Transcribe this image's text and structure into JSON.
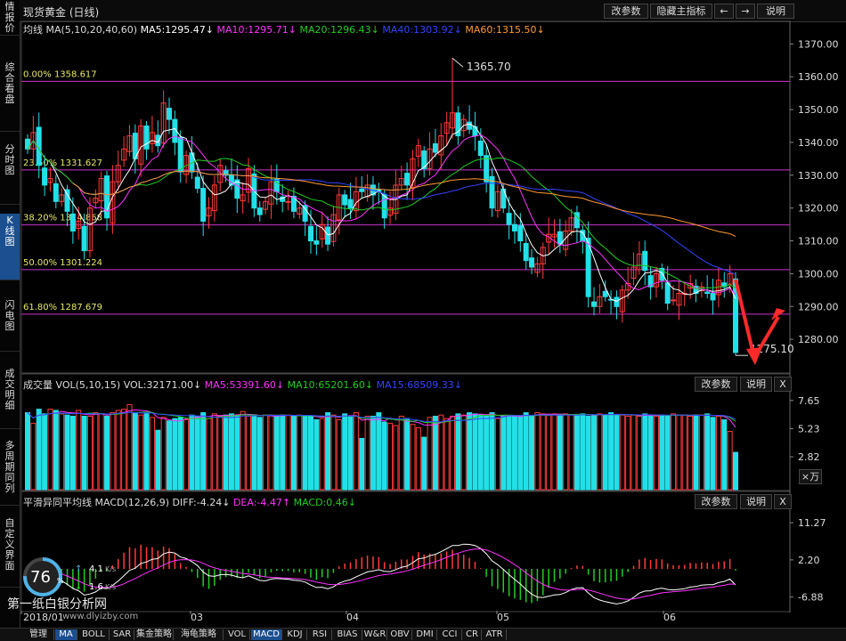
{
  "sidebar": {
    "items": [
      "情报价",
      "综合看盘",
      "分时图",
      "K线图",
      "闪电图",
      "成交明细",
      "多周期同列",
      "自定义界面"
    ],
    "active_index": 3
  },
  "header": {
    "title": "现货黄金 (日线)",
    "buttons": [
      "改参数",
      "隐藏主指标",
      "←",
      "→",
      "说明"
    ]
  },
  "ma_legend": {
    "name": "均线",
    "params": "MA(5,10,20,40,60)",
    "items": [
      {
        "label": "MA5:1295.47↓",
        "color": "#ffffff"
      },
      {
        "label": "MA10:1295.71↓",
        "color": "#ff33ff"
      },
      {
        "label": "MA20:1296.43↓",
        "color": "#22cc22"
      },
      {
        "label": "MA40:1303.92↓",
        "color": "#3344ff"
      },
      {
        "label": "MA60:1315.50↓",
        "color": "#ff9933"
      }
    ]
  },
  "fib_levels": [
    {
      "label": "0.00% 1358.617",
      "value": 1358.617
    },
    {
      "label": "23.60% 1331.627",
      "value": 1331.627
    },
    {
      "label": "38.20% 1314.868",
      "value": 1314.868
    },
    {
      "label": "50.00% 1301.224",
      "value": 1301.224
    },
    {
      "label": "61.80% 1287.679",
      "value": 1287.679
    }
  ],
  "annotations": {
    "high": "1365.70",
    "high_value": 1365.7,
    "low": "1275.10",
    "low_value": 1275.1
  },
  "volume_panel": {
    "title": "成交量",
    "params": "VOL(5,10,15)",
    "items": [
      {
        "label": "VOL:32171.00↓",
        "color": "#dddddd"
      },
      {
        "label": "MA5:53391.60↓",
        "color": "#ff33ff"
      },
      {
        "label": "MA10:65201.60↓",
        "color": "#22cc22"
      },
      {
        "label": "MA15:68509.33↓",
        "color": "#3344ff"
      }
    ],
    "buttons": [
      "改参数",
      "说明",
      "X"
    ],
    "unit": "×万"
  },
  "macd_panel": {
    "title": "平滑异同平均线",
    "params": "MACD(12,26,9)",
    "items": [
      {
        "label": "DIFF:-4.24↓",
        "color": "#dddddd"
      },
      {
        "label": "DEA:-4.47↑",
        "color": "#ff33ff"
      },
      {
        "label": "MACD:0.46↓",
        "color": "#22cc22"
      }
    ],
    "buttons": [
      "改参数",
      "说明",
      "X"
    ]
  },
  "x_axis": {
    "labels": [
      "2018/01",
      "03",
      "04",
      "05",
      "06"
    ]
  },
  "speed": {
    "percent": "76",
    "unit": "%",
    "up": "4.1",
    "up_unit": "K/s",
    "down": "1.6",
    "down_unit": "K/s"
  },
  "watermark": {
    "text": "第一纸白银分析网",
    "url": "www.dlyizby.com"
  },
  "bottom_tabs": [
    "管理",
    "MA",
    "BOLL",
    "SAR",
    "集金策略",
    "海龟策略",
    "VOL",
    "MACD",
    "KDJ",
    "RSI",
    "BIAS",
    "W&R",
    "OBV",
    "DMI",
    "CCI",
    "CR",
    "ATR"
  ],
  "bottom_active": [
    1,
    7
  ],
  "chart_data": {
    "type": "candlestick",
    "price_ylim": [
      1270,
      1372
    ],
    "price_ticks": [
      1370,
      1360,
      1350,
      1340,
      1330,
      1320,
      1310,
      1300,
      1290,
      1280
    ],
    "volume_ticks": [
      "7.65",
      "5.23",
      "2.82"
    ],
    "volume_tick_values": [
      7.65,
      5.23,
      2.82
    ],
    "volume_ylim": [
      0,
      8.4
    ],
    "macd_ticks": [
      "11.27",
      "2.20",
      "-6.88"
    ],
    "macd_tick_values": [
      11.27,
      2.2,
      -6.88
    ],
    "macd_ylim": [
      -10,
      15
    ],
    "series": {
      "close": [
        1338,
        1343,
        1333,
        1327,
        1329,
        1322,
        1324,
        1319,
        1313,
        1316,
        1307,
        1320,
        1323,
        1329,
        1317,
        1328,
        1333,
        1338,
        1342,
        1335,
        1345,
        1338,
        1343,
        1339,
        1352,
        1347,
        1340,
        1331,
        1336,
        1331,
        1326,
        1316,
        1320,
        1327,
        1333,
        1330,
        1327,
        1323,
        1324,
        1332,
        1320,
        1318,
        1322,
        1328,
        1325,
        1322,
        1322,
        1319,
        1320,
        1316,
        1310,
        1309,
        1315,
        1309,
        1318,
        1324,
        1321,
        1320,
        1325,
        1325,
        1327,
        1324,
        1325,
        1317,
        1320,
        1327,
        1329,
        1327,
        1335,
        1339,
        1332,
        1338,
        1337,
        1342,
        1346,
        1349,
        1342,
        1347,
        1344,
        1342,
        1336,
        1328,
        1320,
        1325,
        1320,
        1315,
        1313,
        1310,
        1304,
        1302,
        1303,
        1308,
        1312,
        1312,
        1309,
        1313,
        1317,
        1314,
        1310,
        1293,
        1290,
        1293,
        1293,
        1292,
        1290,
        1295,
        1297,
        1302,
        1306,
        1301,
        1296,
        1300,
        1298,
        1291,
        1292,
        1294,
        1294,
        1297,
        1294,
        1296,
        1294,
        1292,
        1298,
        1296,
        1300,
        1276
      ],
      "volume": [
        6.6,
        5.7,
        6.9,
        6.5,
        6.9,
        6.8,
        6.5,
        6.4,
        6.3,
        6.8,
        6.3,
        6.3,
        6.6,
        6.5,
        6.3,
        6.6,
        6.8,
        6.9,
        7.3,
        6.6,
        6.4,
        6.6,
        6.2,
        5.1,
        6.2,
        5.9,
        6.1,
        6.2,
        6.0,
        6.4,
        6.3,
        6.6,
        6.1,
        6.5,
        6.3,
        6.4,
        6.5,
        6.4,
        6.7,
        6.3,
        6.3,
        6.2,
        6.4,
        6.4,
        6.3,
        6.4,
        6.4,
        6.3,
        6.4,
        6.3,
        6.3,
        6.0,
        6.1,
        6.6,
        6.4,
        6.0,
        6.5,
        6.3,
        6.6,
        4.4,
        6.3,
        6.3,
        6.6,
        5.8,
        5.7,
        5.5,
        6.3,
        6.1,
        5.6,
        5.3,
        4.5,
        6.2,
        6.3,
        6.4,
        6.1,
        6.3,
        6.5,
        6.4,
        6.6,
        6.5,
        6.4,
        6.3,
        6.6,
        6.1,
        6.3,
        6.3,
        6.3,
        6.3,
        6.6,
        6.3,
        6.6,
        6.5,
        6.4,
        6.5,
        6.4,
        6.5,
        6.4,
        6.4,
        6.5,
        6.3,
        6.4,
        6.5,
        6.4,
        6.6,
        6.4,
        6.4,
        6.3,
        6.4,
        6.3,
        6.5,
        6.4,
        6.3,
        6.4,
        6.3,
        6.5,
        6.4,
        6.4,
        6.3,
        6.4,
        6.4,
        6.5,
        6.2,
        6.3,
        6.0,
        5.0,
        3.2
      ]
    }
  }
}
